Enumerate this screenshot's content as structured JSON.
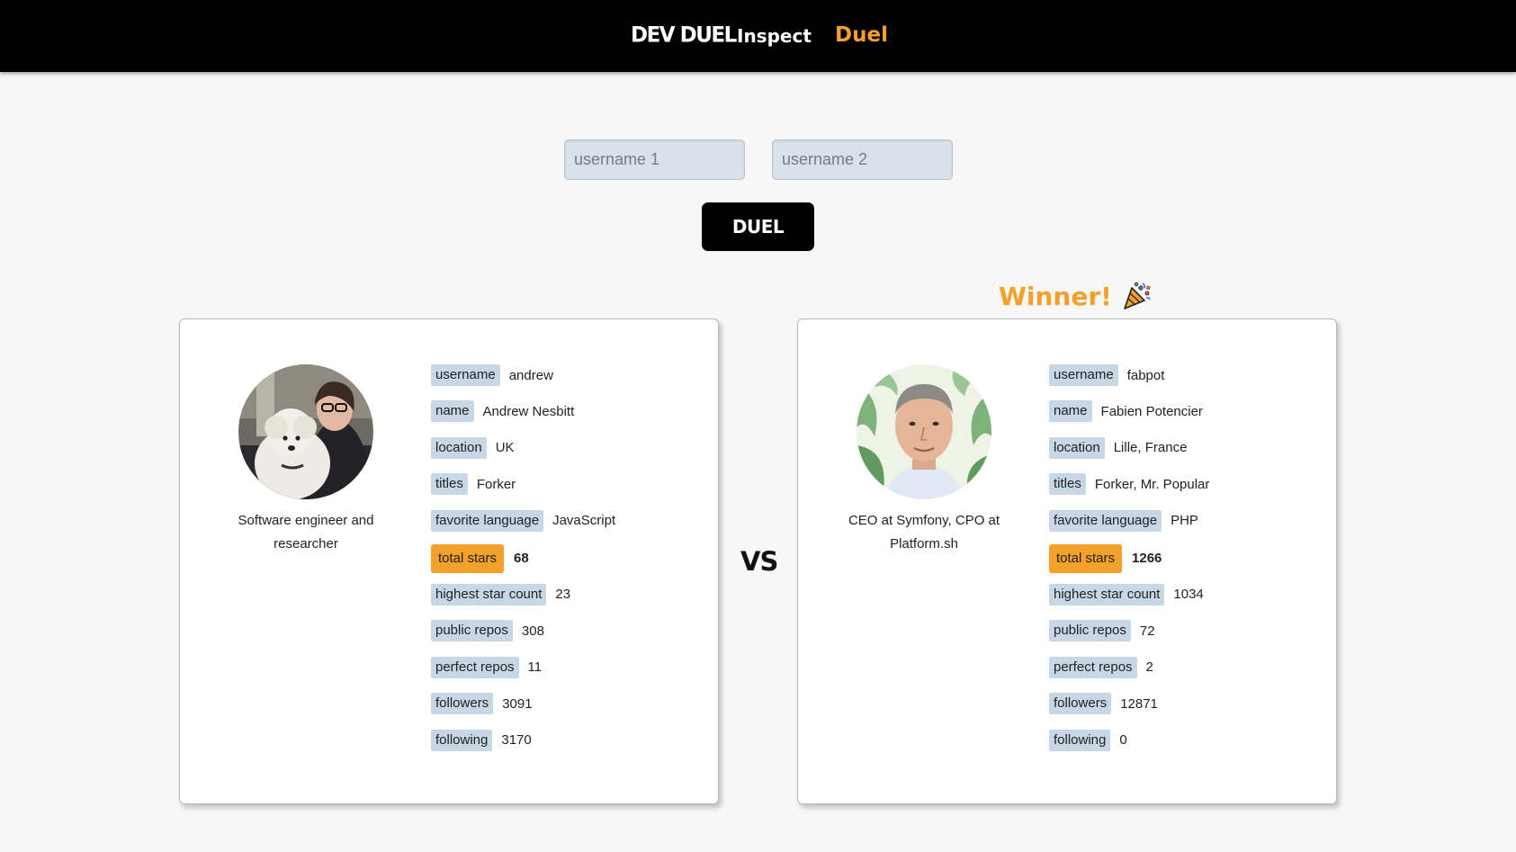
{
  "nav": {
    "brand": "DEV DUEL",
    "inspect": "Inspect",
    "duel": "Duel",
    "accent_color": "#f3a12b"
  },
  "form": {
    "username1_placeholder": "username 1",
    "username2_placeholder": "username 2",
    "username1_value": "",
    "username2_value": "",
    "duel_button": "DUEL"
  },
  "winner_label": "Winner!",
  "winner_icon": "party-popper-icon",
  "vs_label": "VS",
  "players": [
    {
      "bio": "Software engineer and researcher",
      "avatar": "avatar-photo",
      "stats": [
        {
          "label": "username",
          "value": "andrew"
        },
        {
          "label": "name",
          "value": "Andrew Nesbitt"
        },
        {
          "label": "location",
          "value": "UK"
        },
        {
          "label": "titles",
          "value": "Forker"
        },
        {
          "label": "favorite language",
          "value": "JavaScript"
        },
        {
          "label": "total stars",
          "value": "68"
        },
        {
          "label": "highest star count",
          "value": "23"
        },
        {
          "label": "public repos",
          "value": "308"
        },
        {
          "label": "perfect repos",
          "value": "11"
        },
        {
          "label": "followers",
          "value": "3091"
        },
        {
          "label": "following",
          "value": "3170"
        }
      ]
    },
    {
      "bio": "CEO at Symfony, CPO at Platform.sh",
      "avatar": "avatar-photo",
      "winner": true,
      "stats": [
        {
          "label": "username",
          "value": "fabpot"
        },
        {
          "label": "name",
          "value": "Fabien Potencier"
        },
        {
          "label": "location",
          "value": "Lille, France"
        },
        {
          "label": "titles",
          "value": "Forker, Mr. Popular"
        },
        {
          "label": "favorite language",
          "value": "PHP"
        },
        {
          "label": "total stars",
          "value": "1266"
        },
        {
          "label": "highest star count",
          "value": "1034"
        },
        {
          "label": "public repos",
          "value": "72"
        },
        {
          "label": "perfect repos",
          "value": "2"
        },
        {
          "label": "followers",
          "value": "12871"
        },
        {
          "label": "following",
          "value": "0"
        }
      ]
    }
  ]
}
